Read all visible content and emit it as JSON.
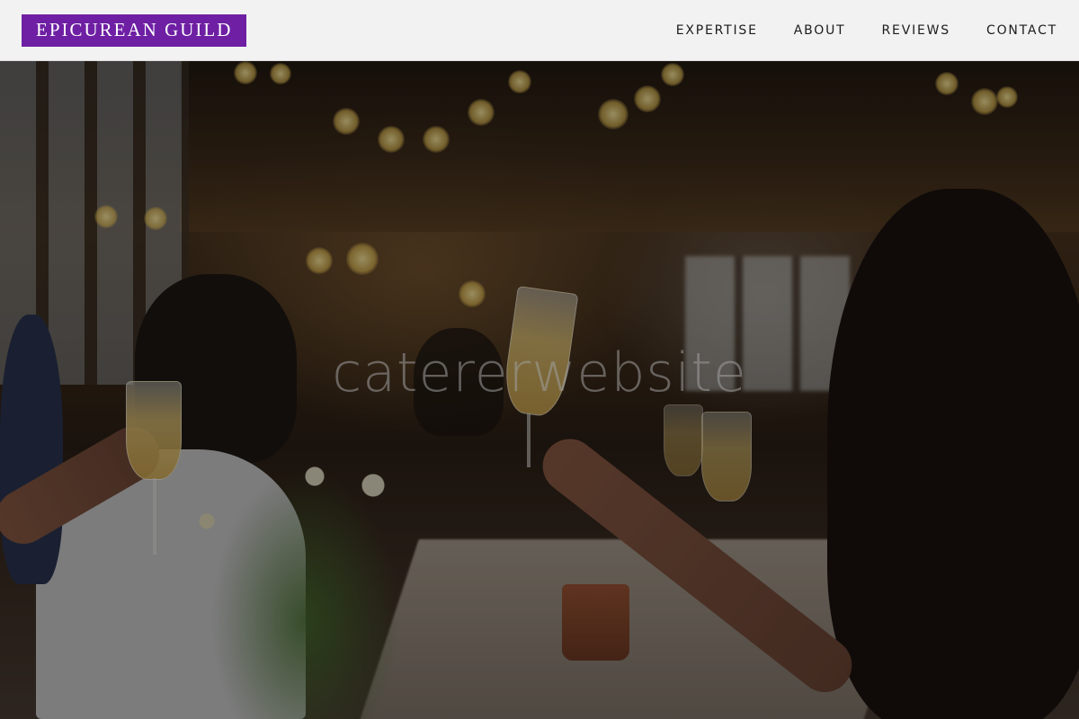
{
  "header": {
    "brand": "EPICUREAN GUILD",
    "nav": [
      {
        "label": "EXPERTISE"
      },
      {
        "label": "ABOUT"
      },
      {
        "label": "REVIEWS"
      },
      {
        "label": "CONTACT"
      }
    ]
  },
  "hero": {
    "watermark_text": "catererwebsite"
  },
  "colors": {
    "brand_bg": "#6e1fa3",
    "nav_bg": "#f2f2f2",
    "nav_text": "#1c1c1c"
  }
}
